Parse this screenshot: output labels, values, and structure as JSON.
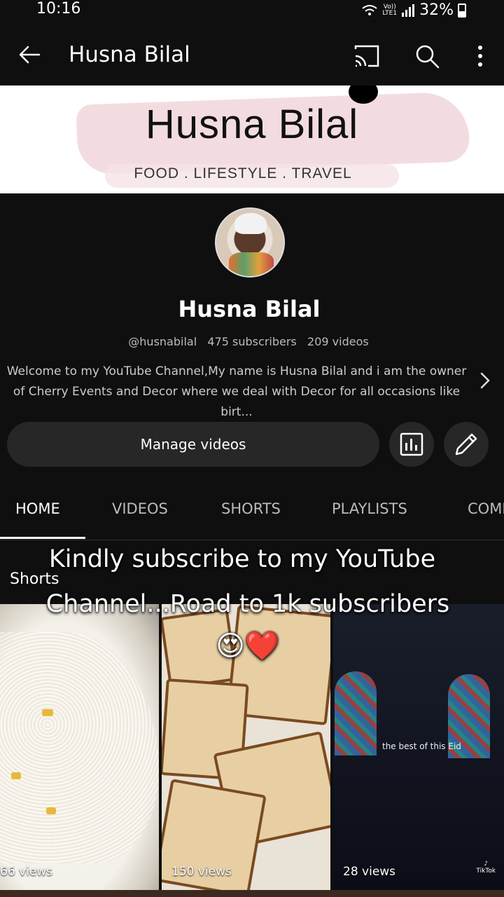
{
  "status": {
    "time": "10:16",
    "network_top": "Vo))",
    "network_bottom": "LTE1",
    "battery": "32%"
  },
  "appbar": {
    "title": "Husna Bilal",
    "icons": [
      "back-arrow-icon",
      "cast-icon",
      "search-icon",
      "more-vert-icon"
    ]
  },
  "banner": {
    "name": "Husna Bilal",
    "tagline": "FOOD . LIFESTYLE . TRAVEL"
  },
  "channel": {
    "name": "Husna Bilal",
    "handle": "@husnabilal",
    "subscribers": "475 subscribers",
    "videos": "209 videos",
    "description_line1": "Welcome to my YouTube Channel,My name is Husna Bilal and i am the owner",
    "description_line2": "of Cherry Events and Decor where we deal with Decor for all occasions like birt..."
  },
  "actions": {
    "manage_videos": "Manage videos"
  },
  "tabs": [
    {
      "label": "HOME",
      "active": true
    },
    {
      "label": "VIDEOS",
      "active": false
    },
    {
      "label": "SHORTS",
      "active": false
    },
    {
      "label": "PLAYLISTS",
      "active": false
    },
    {
      "label": "COMI",
      "active": false
    }
  ],
  "shorts": {
    "title": "Shorts",
    "items": [
      {
        "views": "66 views"
      },
      {
        "views": "150 views"
      },
      {
        "views": "28 views",
        "caption": "the best of this Eid",
        "watermark": "TikTok"
      }
    ]
  },
  "overlay": {
    "line1": "Kindly subscribe to my YouTube",
    "line2": "Channel...Road to 1k subscribers",
    "line3": "😍❤️"
  }
}
